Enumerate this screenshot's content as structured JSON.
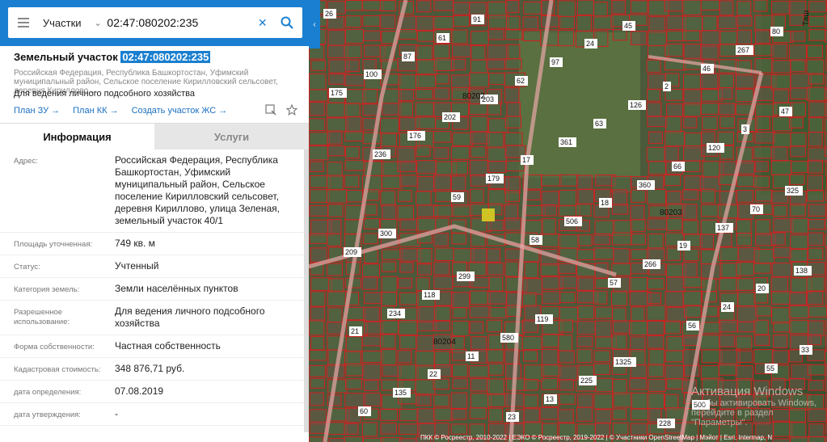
{
  "search": {
    "layer": "Участки",
    "query": "02:47:080202:235",
    "chevron_icon": "chevron-down-icon",
    "clear_icon": "close-icon",
    "search_icon": "search-icon",
    "menu_icon": "menu-icon"
  },
  "parcel": {
    "title_prefix": "Земельный участок",
    "cadastral_number": "02:47:080202:235",
    "subtitle": "Российская Федерация, Республика Башкортостан, Уфимский муниципальный район, Сельское поселение Кирилловский сельсовет, деревня Кириллово,...",
    "purpose": "Для ведения личного подсобного хозяйства",
    "links": [
      "План ЗУ →",
      "План КК →",
      "Создать участок ЖС →"
    ]
  },
  "tabs": [
    "Информация",
    "Услуги"
  ],
  "details": [
    {
      "label": "Адрес:",
      "value": "Российская Федерация, Республика Башкортостан, Уфимский муниципальный район, Сельское поселение Кирилловский сельсовет, деревня Кириллово, улица Зеленая, земельный участок 40/1"
    },
    {
      "label": "Площадь уточненная:",
      "value": "749 кв. м"
    },
    {
      "label": "Статус:",
      "value": "Учтенный"
    },
    {
      "label": "Категория земель:",
      "value": "Земли населённых пунктов"
    },
    {
      "label": "Разрешенное использование:",
      "value": "Для ведения личного подсобного хозяйства"
    },
    {
      "label": "Форма собственности:",
      "value": "Частная собственность"
    },
    {
      "label": "Кадастровая стоимость:",
      "value": "348 876,71 руб."
    },
    {
      "label": "дата определения:",
      "value": "07.08.2019"
    },
    {
      "label": "дата утверждения:",
      "value": "-"
    }
  ],
  "map": {
    "block_labels": [
      "80202",
      "80203",
      "80204"
    ],
    "parcel_numbers": [
      "26",
      "87",
      "203",
      "361",
      "360",
      "137",
      "138",
      "234",
      "11",
      "13",
      "45",
      "46",
      "47",
      "236",
      "59",
      "58",
      "57",
      "56",
      "55",
      "60",
      "61",
      "62",
      "63",
      "66",
      "70",
      "209",
      "118",
      "580",
      "225",
      "228",
      "267",
      "175",
      "176",
      "179",
      "506",
      "266",
      "24",
      "33",
      "135",
      "91",
      "97",
      "126",
      "120",
      "325",
      "300",
      "299",
      "119",
      "1325",
      "500",
      "80",
      "100",
      "202",
      "17",
      "18",
      "19",
      "20",
      "21",
      "22",
      "23",
      "24",
      "2",
      "3"
    ],
    "street_label": "Таш",
    "attribution": "ПКК © Росреестр, 2010-2022 | ЕЭКО © Росреестр, 2019-2022 | © Участники OpenStreetMap | Мэйот | Esri, Intermap, N",
    "watermark_line1": "Активация Windows",
    "watermark_line2": "Чтобы активировать Windows, перейдите в раздел \"Параметры\"."
  },
  "colors": {
    "accent": "#1a7fd0",
    "parcel_border": "#d02020",
    "highlight_parcel": "#e8e020"
  }
}
